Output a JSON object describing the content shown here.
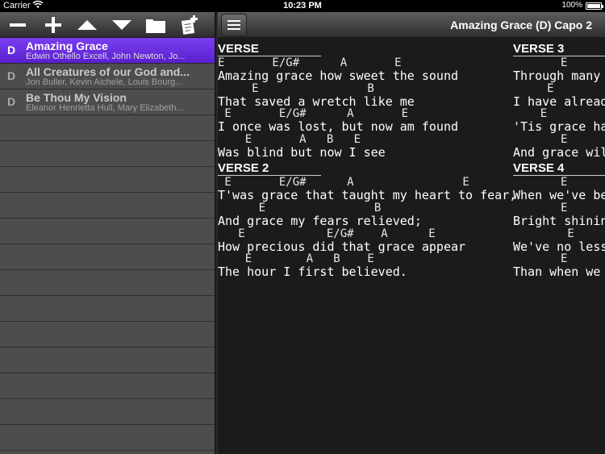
{
  "status_bar": {
    "carrier": "Carrier",
    "time": "10:23 PM",
    "battery": "100%"
  },
  "left_toolbar": {
    "buttons": [
      "remove-icon",
      "add-icon",
      "move-up-icon",
      "move-down-icon",
      "folder-icon",
      "new-set-icon"
    ]
  },
  "songs": [
    {
      "key": "D",
      "title": "Amazing Grace",
      "authors": "Edwin Othello Excell, John Newton, Jo...",
      "selected": true
    },
    {
      "key": "D",
      "title": "All Creatures of our God and...",
      "authors": "Jon Buller, Kevin Aichele, Louis Bourg...",
      "selected": false
    },
    {
      "key": "D",
      "title": "Be Thou My Vision",
      "authors": "Eleanor Henrietta Hull, Mary Elizabeth...",
      "selected": false
    }
  ],
  "header": {
    "title": "Amazing Grace (D) Capo 2"
  },
  "sections_left": [
    {
      "title": "VERSE",
      "lines": [
        {
          "chords": "E       E/G#      A       E",
          "lyrics": "Amazing grace how sweet the sound"
        },
        {
          "chords": "     E                B",
          "lyrics": "That saved a wretch like me"
        },
        {
          "chords": " E       E/G#      A       E",
          "lyrics": "I once was lost, but now am found"
        },
        {
          "chords": "    E       A   B   E",
          "lyrics": "Was blind but now I see"
        }
      ]
    },
    {
      "title": "VERSE 2",
      "lines": [
        {
          "chords": " E       E/G#      A                E",
          "lyrics": "T'was grace that taught my heart to fear,"
        },
        {
          "chords": "      E                B",
          "lyrics": "And grace my fears relieved;"
        },
        {
          "chords": "   E            E/G#    A      E",
          "lyrics": "How precious did that grace appear"
        },
        {
          "chords": "    E        A   B    E",
          "lyrics": "The hour I first believed."
        }
      ]
    }
  ],
  "sections_right": [
    {
      "title": "VERSE 3",
      "lines": [
        {
          "chords": "       E",
          "lyrics": "Through many"
        },
        {
          "chords": "     E",
          "lyrics": "I have already"
        },
        {
          "chords": "    E",
          "lyrics": "'Tis grace has"
        },
        {
          "chords": "       E",
          "lyrics": "And grace will"
        }
      ]
    },
    {
      "title": "VERSE 4",
      "lines": [
        {
          "chords": "       E",
          "lyrics": "When we've be"
        },
        {
          "chords": "       E",
          "lyrics": "Bright shining"
        },
        {
          "chords": "        E",
          "lyrics": "We've no less"
        },
        {
          "chords": "       E",
          "lyrics": "Than when we"
        }
      ]
    }
  ]
}
